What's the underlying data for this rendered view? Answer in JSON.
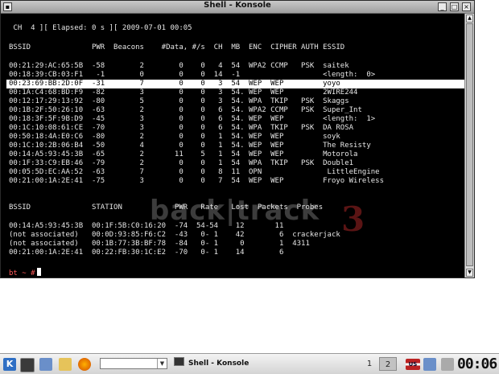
{
  "window": {
    "title": "Shell - Konsole"
  },
  "terminal": {
    "status_line": " CH  4 ][ Elapsed: 0 s ][ 2009-07-01 00:05",
    "ap_header": "BSSID              PWR  Beacons    #Data, #/s  CH  MB  ENC  CIPHER AUTH ESSID",
    "ap_rows": [
      "00:21:29:AC:65:5B  -58        2        0    0   4  54  WPA2 CCMP   PSK  saitek",
      "00:18:39:CB:03:F1   -1        0        0    0  14  -1                   <length:  0>",
      "00:23:69:BB:2D:0F  -31        7        0    0   3  54  WEP  WEP         yoyo",
      "00:1A:C4:68:BD:F9  -82        3        0    0   3  54. WEP  WEP         2WIRE244",
      "00:12:17:29:13:92  -80        5        0    0   3  54. WPA  TKIP   PSK  Skaggs",
      "00:1B:2F:50:26:10  -63        2        0    0   6  54. WPA2 CCMP   PSK  Super_Int",
      "00:18:3F:5F:9B:D9  -45        3        0    0   6  54. WEP  WEP         <length:  1>",
      "00:1C:10:08:61:CE  -70        3        0    0   6  54. WPA  TKIP   PSK  DA ROSA",
      "00:50:18:4A:E0:C6  -80        2        0    0   1  54. WEP  WEP         soyk",
      "00:1C:10:2B:06:B4  -50        4        0    0   1  54. WEP  WEP         The Resisty",
      "00:14:A5:93:45:3B  -65        2       11    5   1  54  WEP  WEP         Motorola",
      "00:1F:33:C9:EB:46  -79        2        0    0   1  54  WPA  TKIP   PSK  Double1",
      "00:05:5D:EC:AA:52  -63        7        0    0   8  11  OPN               LittleEngine",
      "00:21:00:1A:2E:41  -75        3        0    0   7  54  WEP  WEP         Froyo Wireless"
    ],
    "st_header": "BSSID              STATION            PWR   Rate   Lost  Packets  Probes",
    "st_rows": [
      "00:14:A5:93:45:3B  00:1F:5B:C0:16:20  -74  54-54    12       11",
      "(not associated)   00:0D:93:85:F6:C2  -43   0- 1    42        6  crackerjack",
      "(not associated)   00:1B:77:3B:BF:78  -84   0- 1     0        1  4311",
      "00:21:00:1A:2E:41  00:22:FB:30:1C:E2  -70   0- 1    14        6"
    ],
    "prompt": "bt ~ #",
    "wallpaper_logo": "back|track",
    "wallpaper_number": "3"
  },
  "taskbar": {
    "task_label": "Shell - Konsole",
    "desktops": [
      "1",
      "2"
    ],
    "clock": "00:06",
    "locale_flag": "US"
  },
  "colors": {
    "prompt": "#ff5a5a",
    "highlight_bg": "#ffffff",
    "terminal_bg": "#000000"
  }
}
